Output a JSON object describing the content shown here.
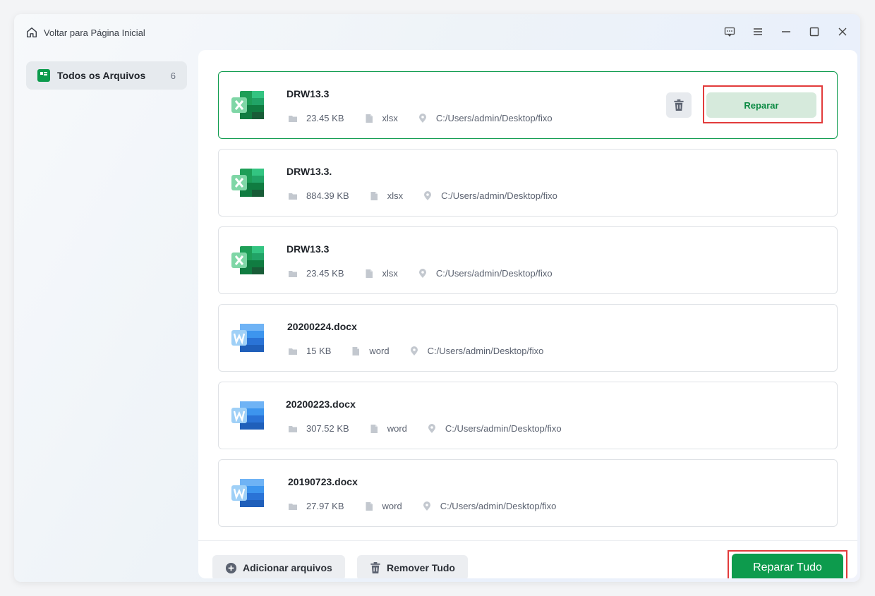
{
  "header": {
    "back_label": "Voltar para Página Inicial"
  },
  "window_controls": [
    "feedback-icon",
    "menu-icon",
    "minimize-icon",
    "maximize-icon",
    "close-icon"
  ],
  "sidebar": {
    "items": [
      {
        "label": "Todos os Arquivos",
        "count": "6"
      }
    ]
  },
  "files": [
    {
      "name": "DRW13.3",
      "size": "23.45 KB",
      "type": "xlsx",
      "path": "C:/Users/admin/Desktop/fixo",
      "kind": "excel"
    },
    {
      "name": "DRW13.3.",
      "size": "884.39 KB",
      "type": "xlsx",
      "path": "C:/Users/admin/Desktop/fixo",
      "kind": "excel"
    },
    {
      "name": "DRW13.3",
      "size": "23.45 KB",
      "type": "xlsx",
      "path": "C:/Users/admin/Desktop/fixo",
      "kind": "excel"
    },
    {
      "name": "20200224.docx",
      "size": "15 KB",
      "type": "word",
      "path": "C:/Users/admin/Desktop/fixo",
      "kind": "word"
    },
    {
      "name": "20200223.docx",
      "size": "307.52 KB",
      "type": "word",
      "path": "C:/Users/admin/Desktop/fixo",
      "kind": "word"
    },
    {
      "name": "20190723.docx",
      "size": "27.97 KB",
      "type": "word",
      "path": "C:/Users/admin/Desktop/fixo",
      "kind": "word"
    }
  ],
  "selected_file": {
    "repair_label": "Reparar"
  },
  "footer": {
    "add_label": "Adicionar arquivos",
    "remove_all_label": "Remover Tudo",
    "repair_all_label": "Reparar Tudo"
  },
  "colors": {
    "accent": "#0d9b4d",
    "highlight": "#e23b3b",
    "excel": "#1e9e57",
    "word": "#2f7fe0"
  }
}
